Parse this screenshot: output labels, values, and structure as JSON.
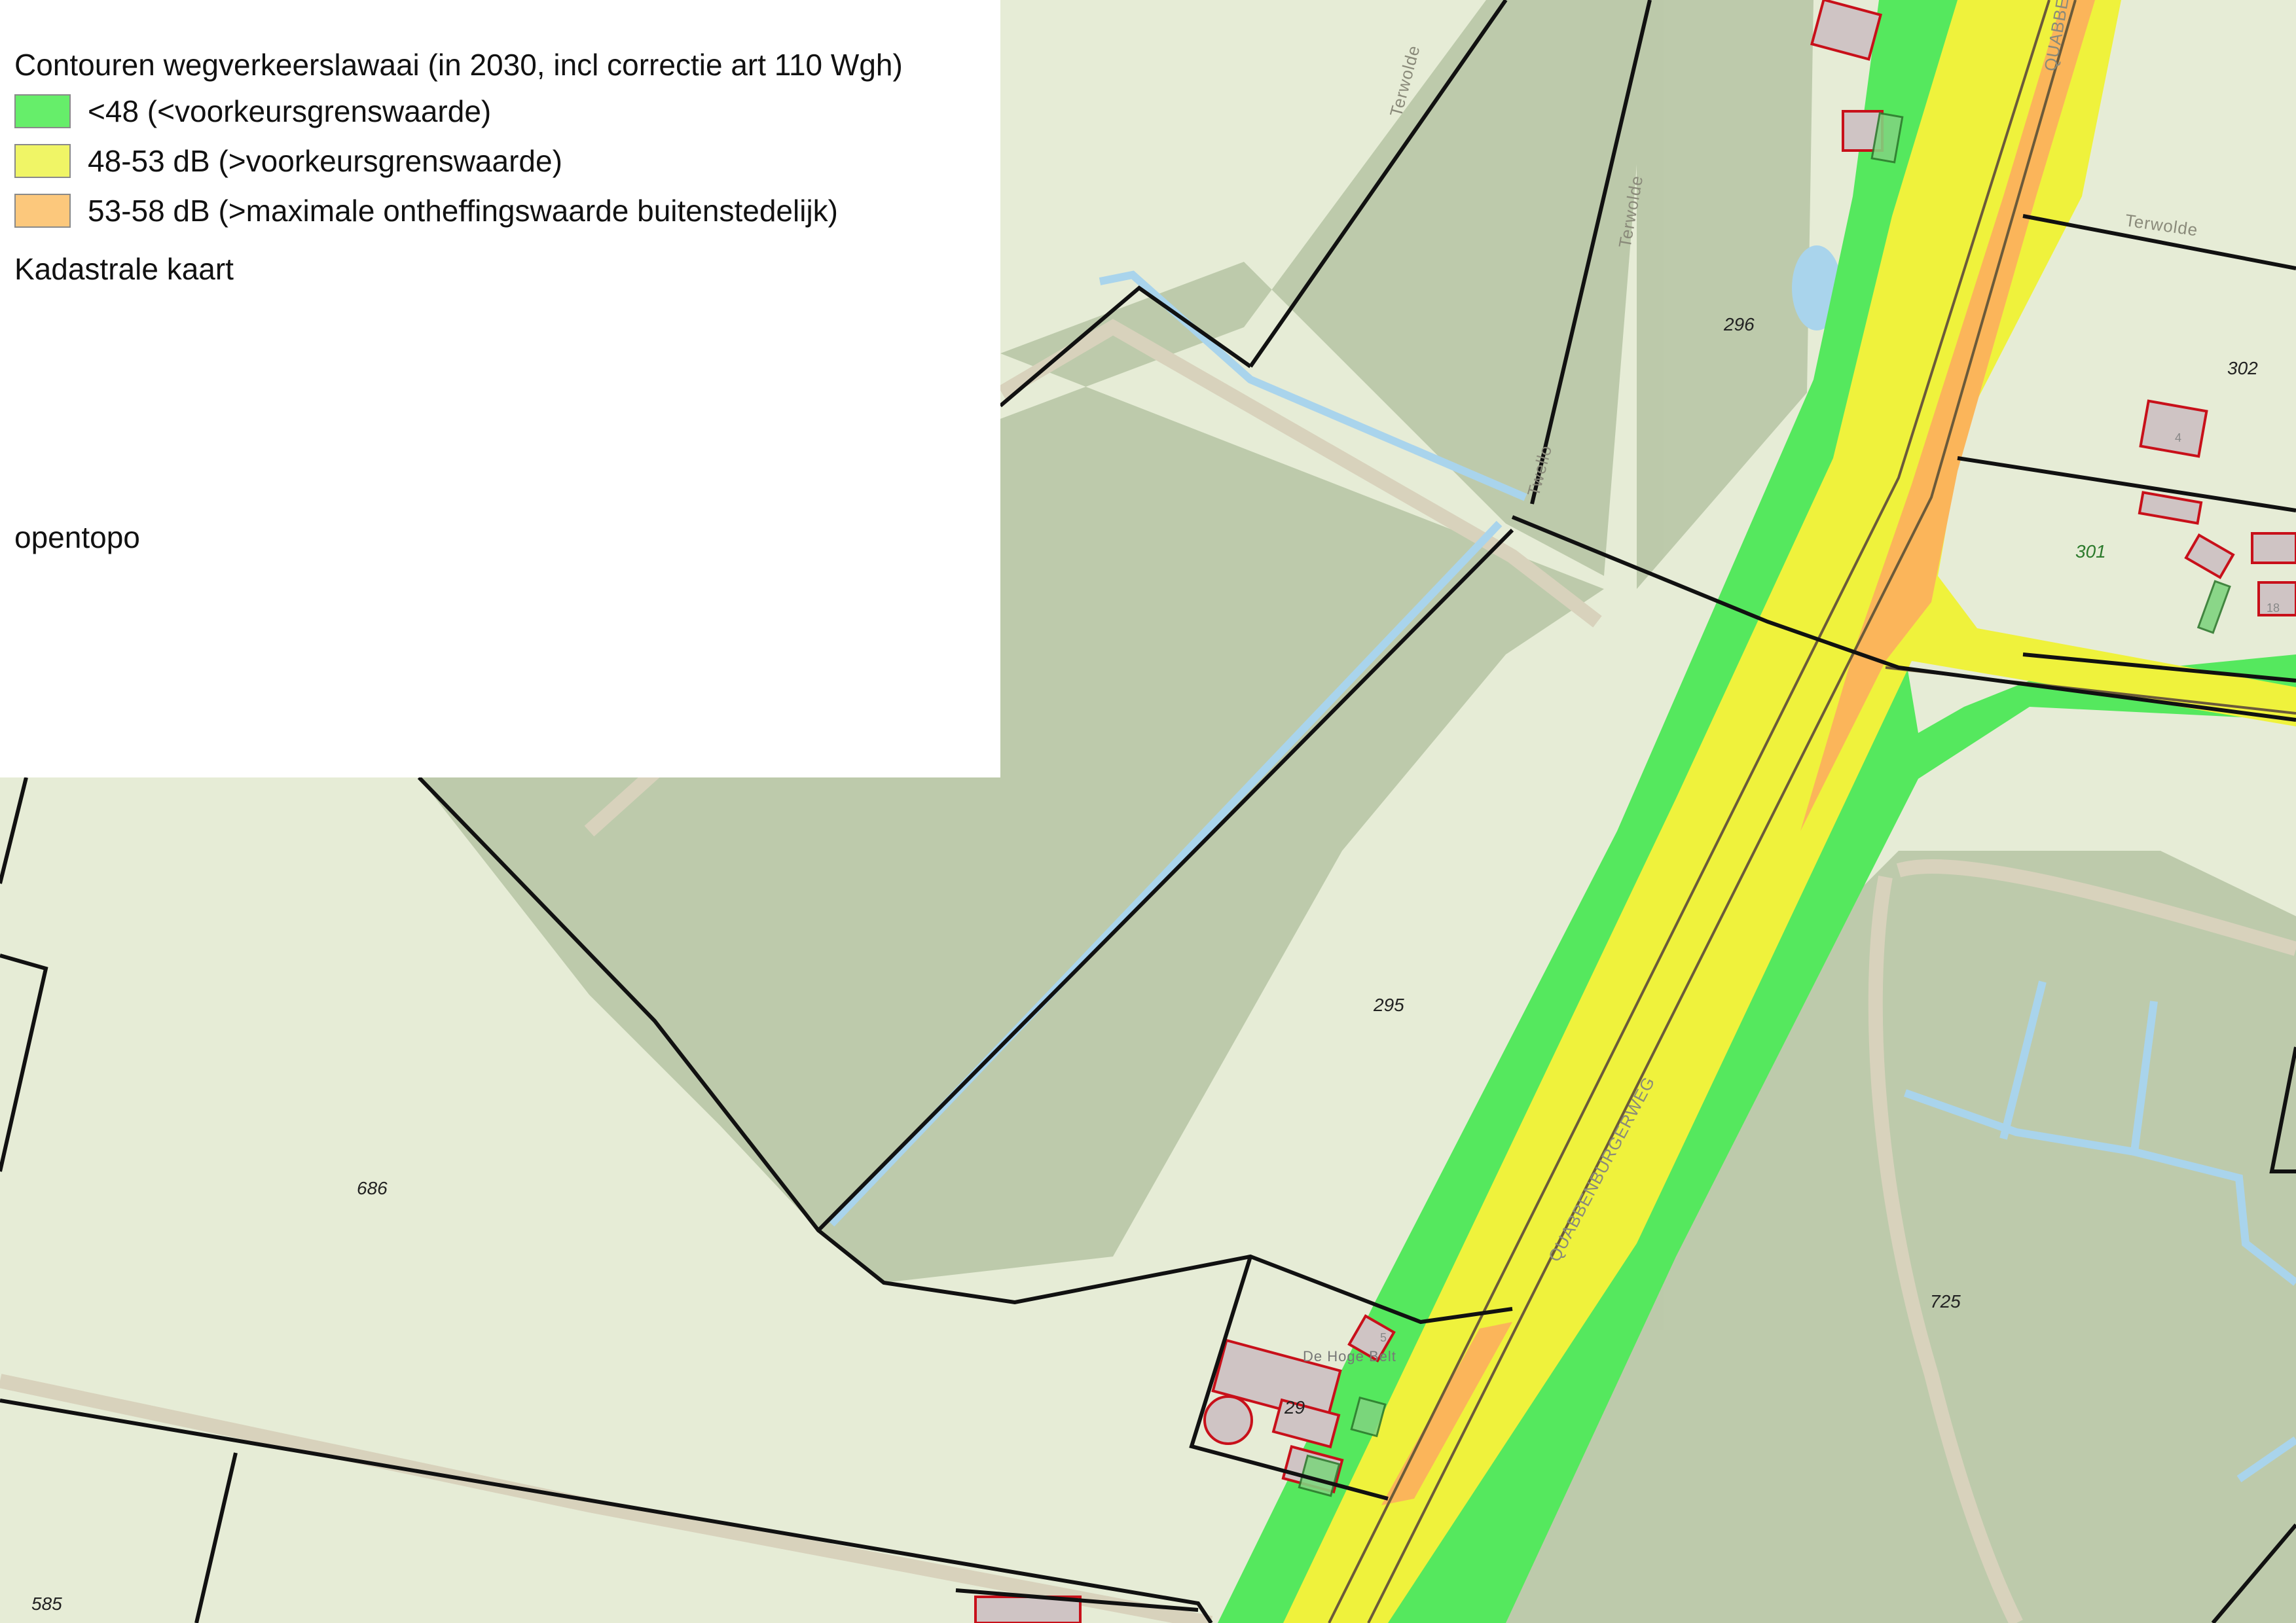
{
  "legend": {
    "title": "Contouren wegverkeerslawaai  (in 2030, incl correctie art 110 Wgh)",
    "items": [
      {
        "label": "<48 (<voorkeursgrenswaarde)",
        "color": "#66ee6a"
      },
      {
        "label": "48-53 dB (>voorkeursgrenswaarde)",
        "color": "#f0f566"
      },
      {
        "label": "53-58 dB (>maximale ontheffingswaarde buitenstedelijk)",
        "color": "#fcc87c"
      }
    ],
    "cadastral_heading": "Kadastrale kaart",
    "basemap_heading": "opentopo"
  },
  "map": {
    "colors": {
      "background": "#e6ecd6",
      "forest": "#b9c7a8",
      "noise_low": "#49e654",
      "noise_mid": "#eef23a",
      "noise_high": "#fbb45a",
      "building_fill": "#c9c1c1",
      "building_stroke": "#c8101a",
      "parcel_line": "#111111",
      "water": "#a9d4ec",
      "path": "#d6d0bd"
    },
    "parcel_numbers": [
      "296",
      "302",
      "301",
      "295",
      "686",
      "725",
      "29",
      "585"
    ],
    "street_names": [
      "Terwolde",
      "Terwolde",
      "Terwolde",
      "Twello",
      "QUABBENBURGERWEG",
      "QUABBENBURGERWEG"
    ],
    "place_label": "De Hoge Belt",
    "house_numbers": [
      "4",
      "5",
      "18"
    ]
  }
}
